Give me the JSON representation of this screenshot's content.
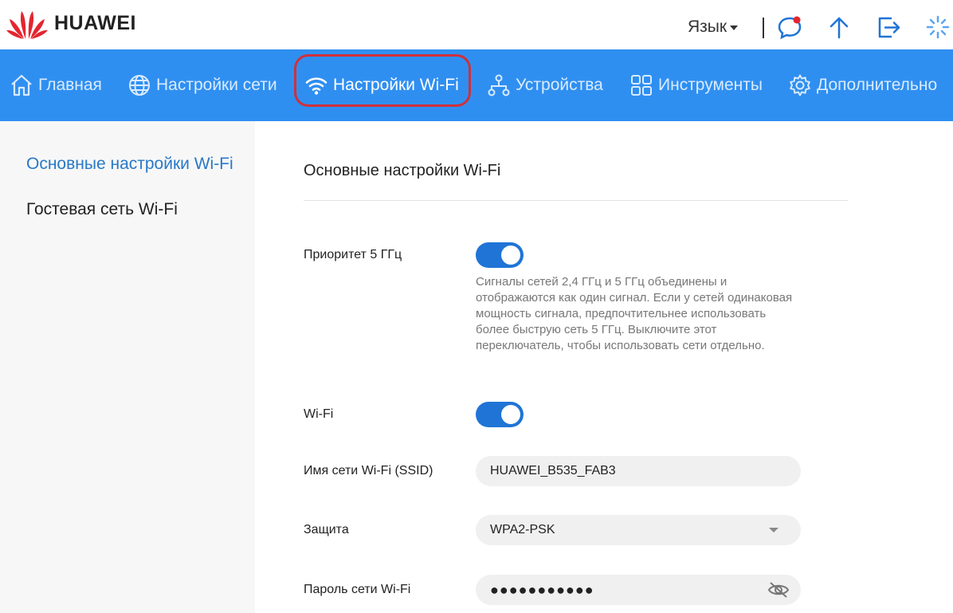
{
  "brand": {
    "name": "HUAWEI",
    "logo_color": "#e4252f"
  },
  "header": {
    "language_label": "Язык",
    "icons": [
      "message-icon",
      "upload-icon",
      "logout-icon",
      "loading-icon"
    ]
  },
  "nav": {
    "accent_color": "#2f8ff1",
    "highlight_color": "#d0303a",
    "items": [
      {
        "label": "Главная",
        "icon": "home-icon"
      },
      {
        "label": "Настройки сети",
        "icon": "globe-icon"
      },
      {
        "label": "Настройки Wi-Fi",
        "icon": "wifi-icon",
        "active": true
      },
      {
        "label": "Устройства",
        "icon": "devices-icon"
      },
      {
        "label": "Инструменты",
        "icon": "tools-icon"
      },
      {
        "label": "Дополнительно",
        "icon": "gear-icon"
      }
    ]
  },
  "sidebar": {
    "items": [
      {
        "label": "Основные настройки Wi-Fi",
        "active": true
      },
      {
        "label": "Гостевая сеть Wi-Fi"
      }
    ]
  },
  "main": {
    "title": "Основные настройки Wi-Fi",
    "priority": {
      "label": "Приоритет 5 ГГц",
      "enabled": true,
      "hint": "Сигналы сетей 2,4 ГГц и 5 ГГц объединены и отображаются как один сигнал. Если у сетей одинаковая мощность сигнала, предпочтительнее использовать более быструю сеть 5 ГГц. Выключите этот переключатель, чтобы использовать сети отдельно."
    },
    "wifi": {
      "label": "Wi-Fi",
      "enabled": true
    },
    "ssid": {
      "label": "Имя сети Wi-Fi (SSID)",
      "value": "HUAWEI_B535_FAB3"
    },
    "security": {
      "label": "Защита",
      "value": "WPA2-PSK"
    },
    "password": {
      "label": "Пароль сети Wi-Fi",
      "masked_value": "●●●●●●●●●●●"
    }
  }
}
